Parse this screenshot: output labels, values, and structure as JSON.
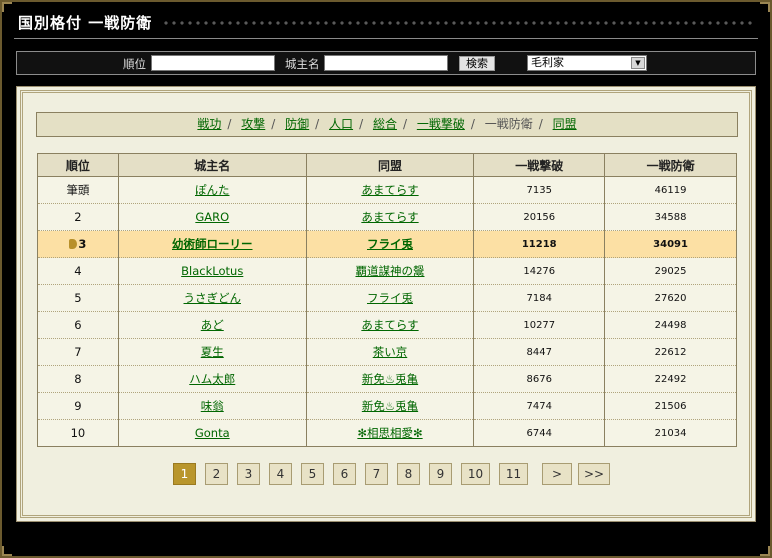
{
  "header": {
    "title": "国別格付 一戦防衛"
  },
  "search": {
    "rank_label": "順位",
    "lord_label": "城主名",
    "button_label": "検索",
    "rank_value": "",
    "lord_value": "",
    "country_selected": "毛利家"
  },
  "tabs": [
    {
      "label": "戦功"
    },
    {
      "label": "攻撃"
    },
    {
      "label": "防御"
    },
    {
      "label": "人口"
    },
    {
      "label": "総合"
    },
    {
      "label": "一戦撃破"
    },
    {
      "label": "一戦防衛"
    },
    {
      "label": "同盟"
    }
  ],
  "table": {
    "headers": [
      "順位",
      "城主名",
      "同盟",
      "一戦撃破",
      "一戦防衛"
    ],
    "rows": [
      {
        "rank": "筆頭",
        "lord": "ぽんた",
        "alliance": "あまてらす",
        "win": "7135",
        "defense": "46119"
      },
      {
        "rank": "2",
        "lord": "GARO",
        "alliance": "あまてらす",
        "win": "20156",
        "defense": "34588"
      },
      {
        "rank": "3",
        "lord": "幼術師ローリー",
        "alliance": "フライ兎",
        "win": "11218",
        "defense": "34091"
      },
      {
        "rank": "4",
        "lord": "BlackLotus",
        "alliance": "覇道謀神の鬶",
        "win": "14276",
        "defense": "29025"
      },
      {
        "rank": "5",
        "lord": "うさぎどん",
        "alliance": "フライ兎",
        "win": "7184",
        "defense": "27620"
      },
      {
        "rank": "6",
        "lord": "あど",
        "alliance": "あまてらす",
        "win": "10277",
        "defense": "24498"
      },
      {
        "rank": "7",
        "lord": "夏生",
        "alliance": "茶い京",
        "win": "8447",
        "defense": "22612"
      },
      {
        "rank": "8",
        "lord": "ハム太郎",
        "alliance": "新免♨兎亀",
        "win": "8676",
        "defense": "22492"
      },
      {
        "rank": "9",
        "lord": "味翁",
        "alliance": "新免♨兎亀",
        "win": "7474",
        "defense": "21506"
      },
      {
        "rank": "10",
        "lord": "Gonta",
        "alliance": "✻相思相愛✻",
        "win": "6744",
        "defense": "21034"
      }
    ],
    "highlight_row": 2
  },
  "pager": {
    "pages": [
      "1",
      "2",
      "3",
      "4",
      "5",
      "6",
      "7",
      "8",
      "9",
      "10",
      "11"
    ],
    "next": ">",
    "last": ">>",
    "current": "1"
  },
  "colors": {
    "link": "#006600",
    "highlight": "#fce0a4",
    "active_page": "#b9962c"
  }
}
